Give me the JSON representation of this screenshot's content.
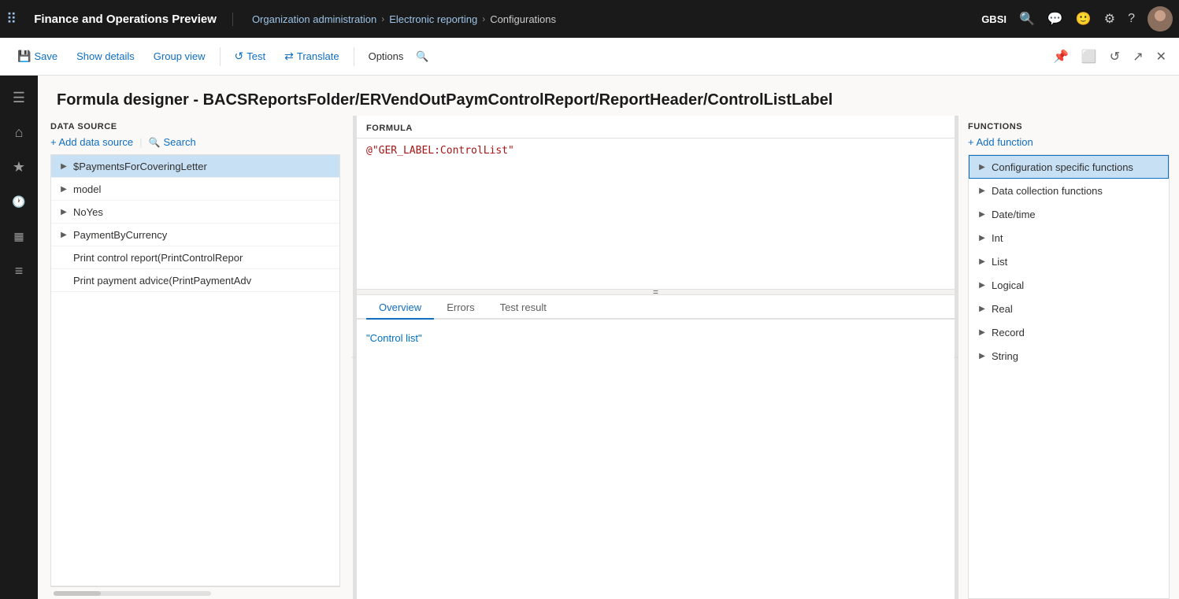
{
  "app": {
    "title": "Finance and Operations Preview"
  },
  "breadcrumb": {
    "items": [
      {
        "label": "Organization administration"
      },
      {
        "label": "Electronic reporting"
      },
      {
        "label": "Configurations"
      }
    ]
  },
  "top_bar": {
    "org_code": "GBSI",
    "search_icon": "🔍",
    "chat_icon": "💬",
    "emoji_icon": "🙂",
    "settings_icon": "⚙",
    "help_icon": "?"
  },
  "toolbar": {
    "save_label": "Save",
    "show_details_label": "Show details",
    "group_view_label": "Group view",
    "test_label": "Test",
    "translate_label": "Translate",
    "options_label": "Options"
  },
  "page": {
    "title": "Formula designer - BACSReportsFolder/ERVendOutPaymControlReport/ReportHeader/ControlListLabel"
  },
  "data_source": {
    "header": "DATA SOURCE",
    "add_label": "+ Add data source",
    "search_label": "Search",
    "items": [
      {
        "label": "$PaymentsForCoveringLetter",
        "has_children": true,
        "selected": true
      },
      {
        "label": "model",
        "has_children": true,
        "selected": false
      },
      {
        "label": "NoYes",
        "has_children": true,
        "selected": false
      },
      {
        "label": "PaymentByCurrency",
        "has_children": true,
        "selected": false
      },
      {
        "label": "Print control report(PrintControlRepor",
        "has_children": false,
        "selected": false
      },
      {
        "label": "Print payment advice(PrintPaymentAdv",
        "has_children": false,
        "selected": false
      }
    ]
  },
  "formula": {
    "header": "FORMULA",
    "value": "@\"GER_LABEL:ControlList\""
  },
  "tabs": {
    "items": [
      {
        "label": "Overview",
        "active": true
      },
      {
        "label": "Errors",
        "active": false
      },
      {
        "label": "Test result",
        "active": false
      }
    ]
  },
  "overview": {
    "text": "\"Control list\""
  },
  "functions": {
    "header": "FUNCTIONS",
    "add_label": "+ Add function",
    "items": [
      {
        "label": "Configuration specific functions",
        "has_children": true,
        "selected": true
      },
      {
        "label": "Data collection functions",
        "has_children": true,
        "selected": false
      },
      {
        "label": "Date/time",
        "has_children": true,
        "selected": false
      },
      {
        "label": "Int",
        "has_children": true,
        "selected": false
      },
      {
        "label": "List",
        "has_children": true,
        "selected": false
      },
      {
        "label": "Logical",
        "has_children": true,
        "selected": false
      },
      {
        "label": "Real",
        "has_children": true,
        "selected": false
      },
      {
        "label": "Record",
        "has_children": true,
        "selected": false
      },
      {
        "label": "String",
        "has_children": true,
        "selected": false
      }
    ]
  },
  "left_nav": {
    "items": [
      {
        "icon": "☰",
        "name": "menu-icon"
      },
      {
        "icon": "⌂",
        "name": "home-icon"
      },
      {
        "icon": "★",
        "name": "favorites-icon"
      },
      {
        "icon": "🕐",
        "name": "recent-icon"
      },
      {
        "icon": "📅",
        "name": "workspaces-icon"
      },
      {
        "icon": "≡",
        "name": "modules-icon"
      }
    ]
  }
}
